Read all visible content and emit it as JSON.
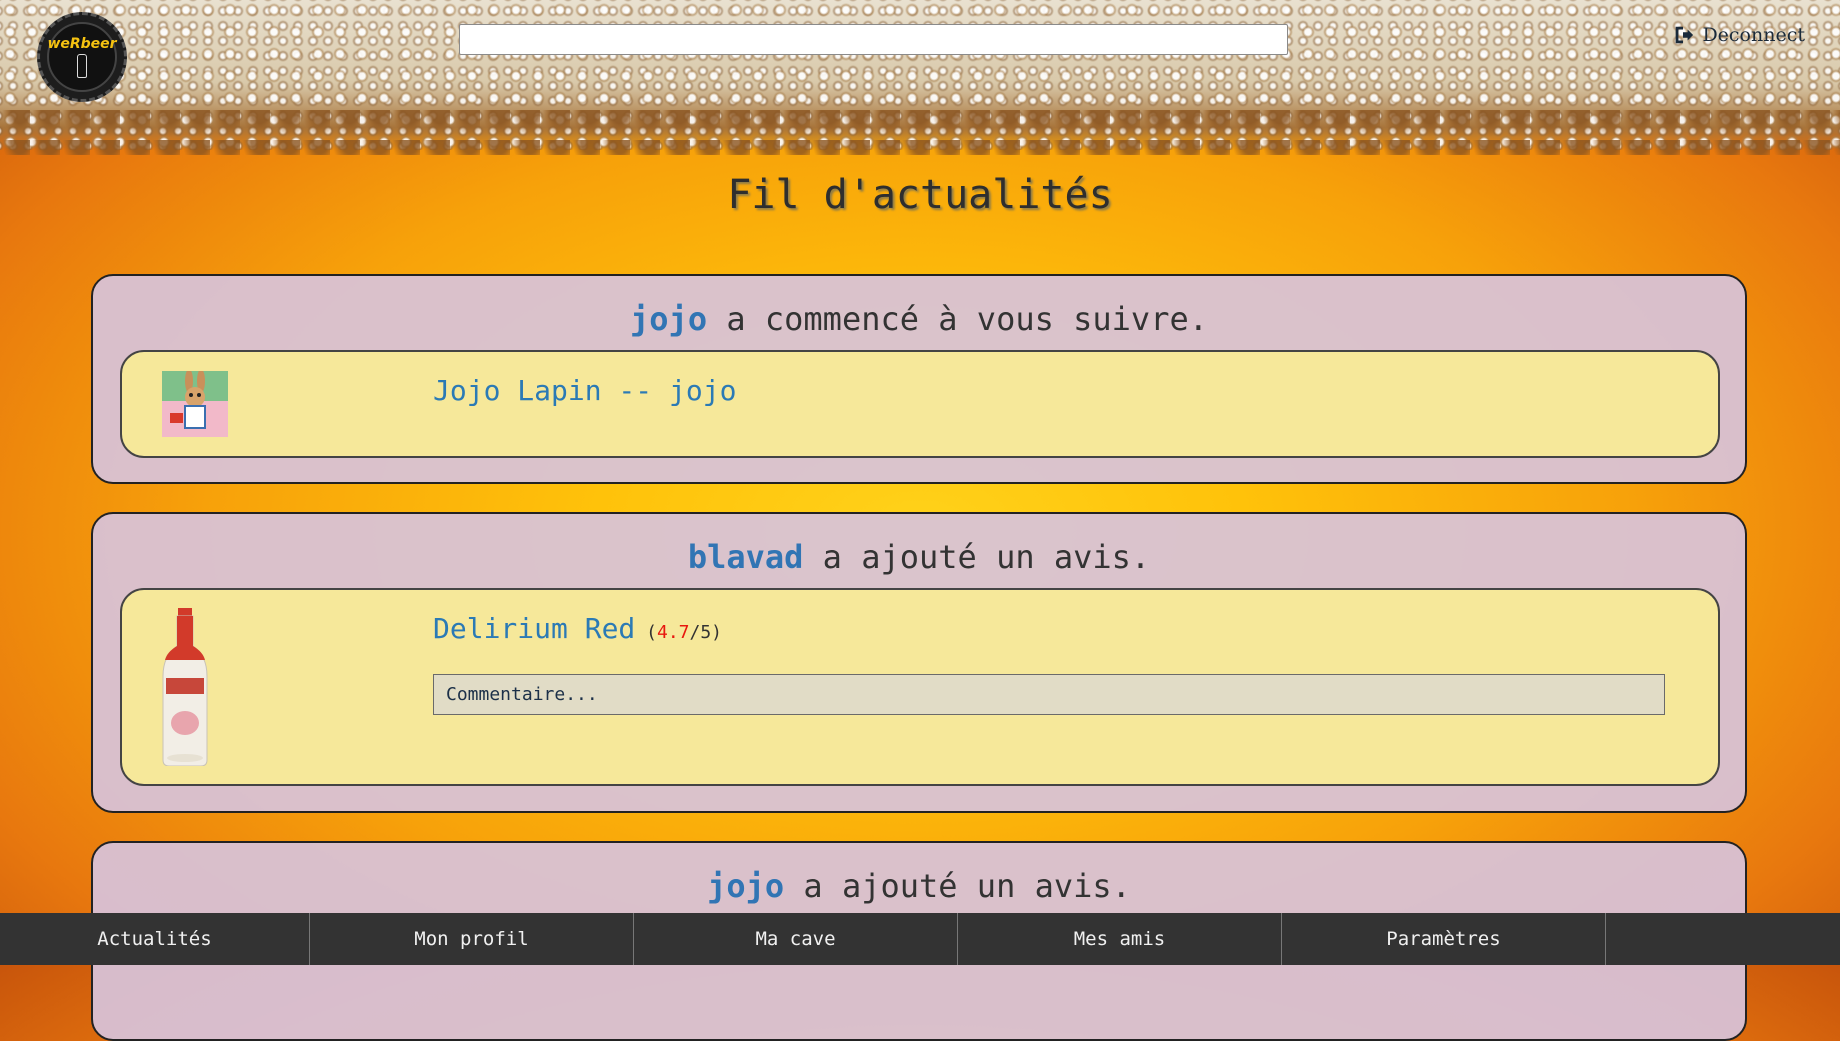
{
  "header": {
    "logo_text": "weRbeer",
    "search_value": "",
    "deconnect_label": "Deconnect"
  },
  "page_title": "Fil d'actualités",
  "feed": [
    {
      "user": "jojo",
      "action": " a commencé à vous suivre.",
      "link": "Jojo Lapin -- jojo",
      "thumb_icon": "rabbit-avatar-icon"
    },
    {
      "user": "blavad",
      "action": " a ajouté un avis.",
      "link": "Delirium Red",
      "rating_open": " (",
      "rating_value": "4.7",
      "rating_rest": "/5)",
      "comment_placeholder": "Commentaire...",
      "thumb_icon": "beer-bottle-icon"
    },
    {
      "user": "jojo",
      "action": " a ajouté un avis."
    }
  ],
  "nav": [
    "Actualités",
    "Mon profil",
    "Ma cave",
    "Mes amis",
    "Paramètres"
  ],
  "colors": {
    "username": "#3175b4",
    "rating": "#e8170e",
    "card_bg": "#d7c3da",
    "inner_bg": "#f6e89a",
    "nav_bg": "#333333"
  }
}
